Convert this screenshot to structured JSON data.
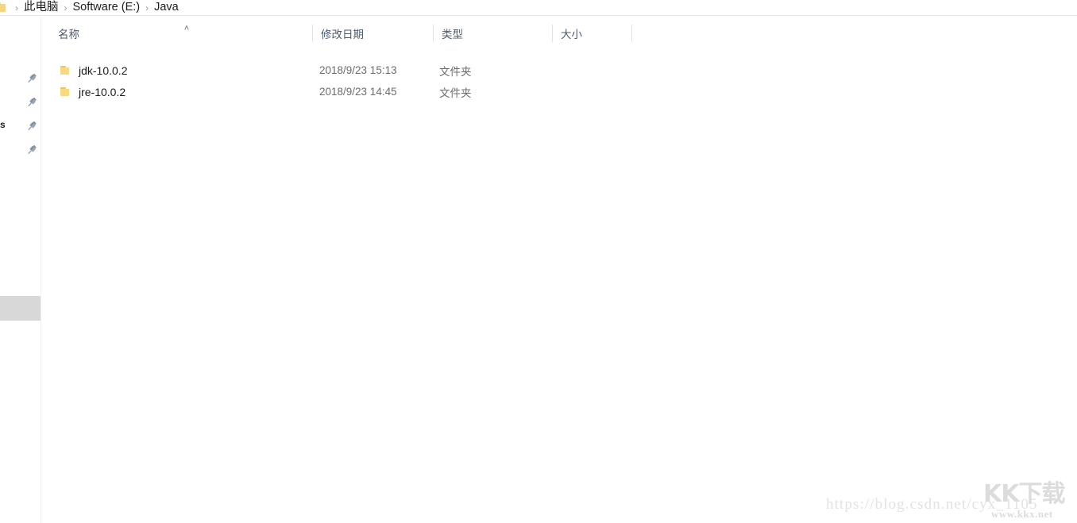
{
  "window": {
    "title": "Java",
    "background_color": "#ffffff"
  },
  "breadcrumb": {
    "icon": "folder-icon",
    "separator": "›",
    "items": [
      {
        "label": "此电脑"
      },
      {
        "label": "Software (E:)"
      },
      {
        "label": "Java"
      }
    ]
  },
  "nav_pane": {
    "pins": [
      {
        "icon": "pushpin-icon"
      },
      {
        "icon": "pushpin-icon"
      },
      {
        "icon": "pushpin-icon"
      },
      {
        "icon": "pushpin-icon"
      }
    ],
    "selected_item": {
      "label": ""
    },
    "clipped_labels": [
      {
        "text": ""
      },
      {
        "text": "s"
      }
    ]
  },
  "file_list": {
    "sort": {
      "column": "名称",
      "direction": "ascending",
      "glyph": "˄"
    },
    "columns": [
      {
        "key": "name",
        "label": "名称"
      },
      {
        "key": "date_modified",
        "label": "修改日期"
      },
      {
        "key": "type",
        "label": "类型"
      },
      {
        "key": "size",
        "label": "大小"
      }
    ],
    "rows": [
      {
        "icon": "folder-icon",
        "name": "jdk-10.0.2",
        "date_modified": "2018/9/23 15:13",
        "type": "文件夹",
        "size": ""
      },
      {
        "icon": "folder-icon",
        "name": "jre-10.0.2",
        "date_modified": "2018/9/23 14:45",
        "type": "文件夹",
        "size": ""
      }
    ]
  },
  "watermarks": {
    "url": "https://blog.csdn.net/cyx_1105",
    "logo_text": "KK下载",
    "logo_site": "www.kkx.net"
  },
  "colors": {
    "folder_yellow": "#f7d982",
    "header_text": "#4d5b6e",
    "body_text": "#1a1a1a",
    "muted_text": "#6d6d6d",
    "divider": "#e2e2e2",
    "selection_gray": "#d8d8d8",
    "watermark_gray": "#e2e2e2"
  }
}
